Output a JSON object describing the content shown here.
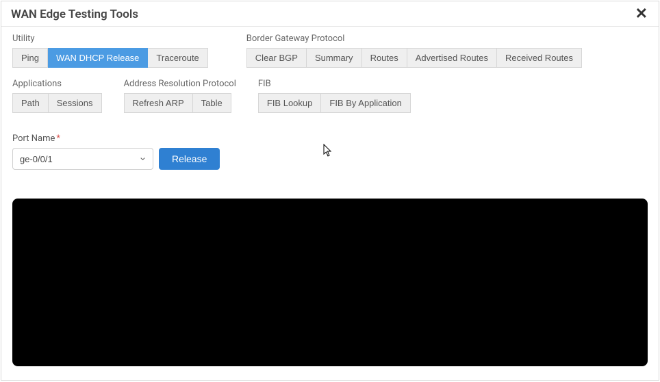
{
  "header": {
    "title": "WAN Edge Testing Tools"
  },
  "groups": {
    "utility": {
      "label": "Utility",
      "ping": "Ping",
      "dhcp": "WAN DHCP Release",
      "traceroute": "Traceroute"
    },
    "bgp": {
      "label": "Border Gateway Protocol",
      "clear": "Clear BGP",
      "summary": "Summary",
      "routes": "Routes",
      "advertised": "Advertised Routes",
      "received": "Received Routes"
    },
    "apps": {
      "label": "Applications",
      "path": "Path",
      "sessions": "Sessions"
    },
    "arp": {
      "label": "Address Resolution Protocol",
      "refresh": "Refresh ARP",
      "table": "Table"
    },
    "fib": {
      "label": "FIB",
      "lookup": "FIB Lookup",
      "byapp": "FIB By Application"
    }
  },
  "form": {
    "port_label": "Port Name",
    "port_value": "ge-0/0/1",
    "release_label": "Release"
  }
}
